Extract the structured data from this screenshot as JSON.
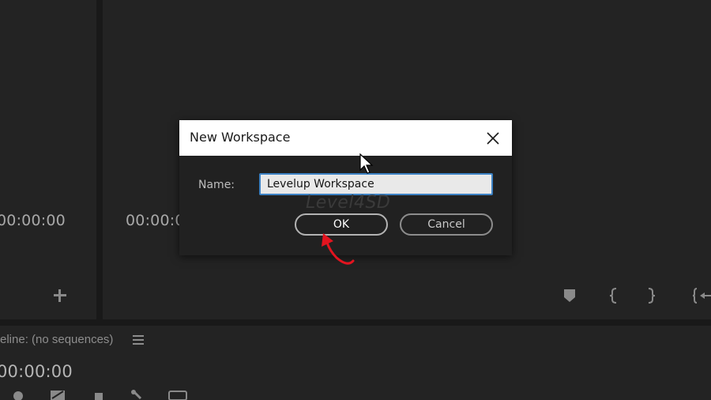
{
  "source_monitor": {
    "timecode": "00:00:00",
    "add_icon": "plus-icon"
  },
  "program_monitor": {
    "timecode": "00:00:0",
    "controls": [
      "marker-icon",
      "mark-in-icon",
      "mark-out-icon",
      "go-to-in-icon"
    ]
  },
  "timeline": {
    "title": "eline: (no sequences)",
    "timecode": "00:00:00",
    "menu_icon": "hamburger-icon"
  },
  "dialog": {
    "title": "New Workspace",
    "name_label": "Name:",
    "name_value": "Levelup Workspace",
    "ok_label": "OK",
    "cancel_label": "Cancel",
    "watermark": "Level4SD"
  },
  "colors": {
    "panel_bg": "#232323",
    "app_bg": "#1d1d1d",
    "dialog_bg": "#212121",
    "input_focus": "#3d82c4",
    "annotation_arrow": "#e3141f"
  }
}
